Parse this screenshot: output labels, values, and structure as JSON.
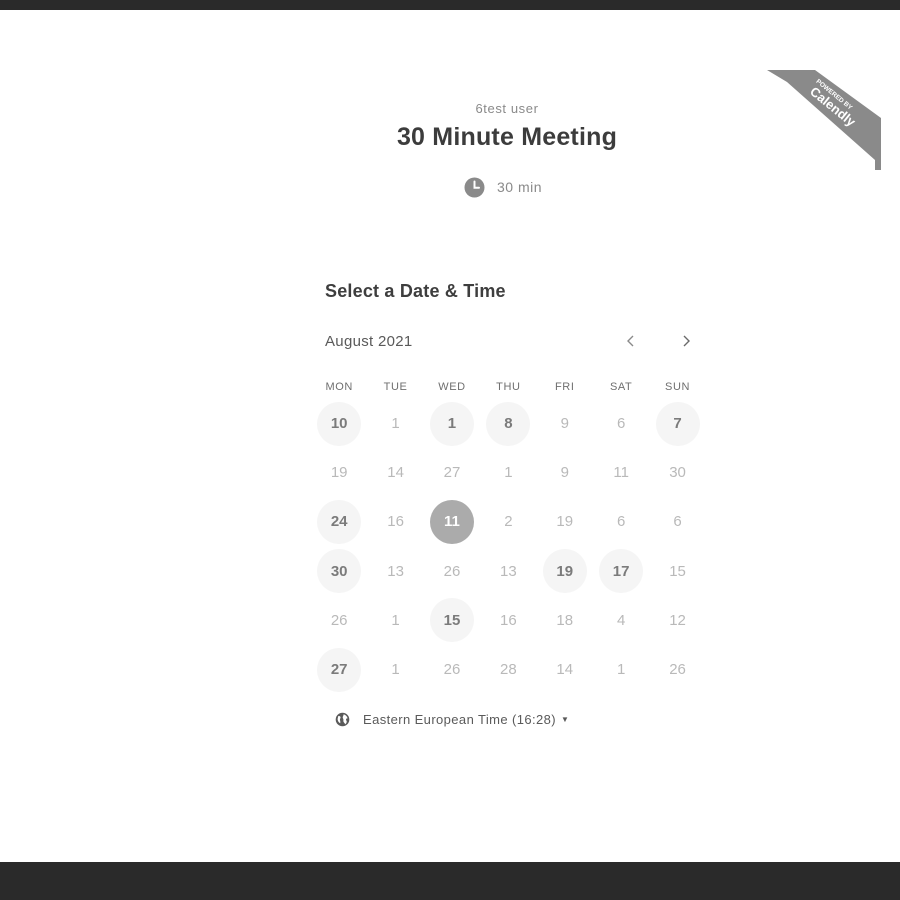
{
  "organizer": "6test user",
  "event_title": "30 Minute Meeting",
  "duration": "30 min",
  "ribbon": {
    "line1": "POWERED BY",
    "line2": "Calendly"
  },
  "section_title": "Select a Date & Time",
  "calendar": {
    "month_label": "August 2021",
    "weekdays": [
      "MON",
      "TUE",
      "WED",
      "THU",
      "FRI",
      "SAT",
      "SUN"
    ],
    "days": [
      {
        "label": "10",
        "state": "available"
      },
      {
        "label": "1",
        "state": "unavailable"
      },
      {
        "label": "1",
        "state": "available"
      },
      {
        "label": "8",
        "state": "available"
      },
      {
        "label": "9",
        "state": "unavailable"
      },
      {
        "label": "6",
        "state": "unavailable"
      },
      {
        "label": "7",
        "state": "available"
      },
      {
        "label": "19",
        "state": "unavailable"
      },
      {
        "label": "14",
        "state": "unavailable"
      },
      {
        "label": "27",
        "state": "unavailable"
      },
      {
        "label": "1",
        "state": "unavailable"
      },
      {
        "label": "9",
        "state": "unavailable"
      },
      {
        "label": "11",
        "state": "unavailable"
      },
      {
        "label": "30",
        "state": "unavailable"
      },
      {
        "label": "24",
        "state": "available"
      },
      {
        "label": "16",
        "state": "unavailable"
      },
      {
        "label": "11",
        "state": "selected"
      },
      {
        "label": "2",
        "state": "unavailable"
      },
      {
        "label": "19",
        "state": "unavailable"
      },
      {
        "label": "6",
        "state": "unavailable"
      },
      {
        "label": "6",
        "state": "unavailable"
      },
      {
        "label": "30",
        "state": "available"
      },
      {
        "label": "13",
        "state": "unavailable"
      },
      {
        "label": "26",
        "state": "unavailable"
      },
      {
        "label": "13",
        "state": "unavailable"
      },
      {
        "label": "19",
        "state": "available"
      },
      {
        "label": "17",
        "state": "available"
      },
      {
        "label": "15",
        "state": "unavailable"
      },
      {
        "label": "26",
        "state": "unavailable"
      },
      {
        "label": "1",
        "state": "unavailable"
      },
      {
        "label": "15",
        "state": "available"
      },
      {
        "label": "16",
        "state": "unavailable"
      },
      {
        "label": "18",
        "state": "unavailable"
      },
      {
        "label": "4",
        "state": "unavailable"
      },
      {
        "label": "12",
        "state": "unavailable"
      },
      {
        "label": "27",
        "state": "available"
      },
      {
        "label": "1",
        "state": "unavailable"
      },
      {
        "label": "26",
        "state": "unavailable"
      },
      {
        "label": "28",
        "state": "unavailable"
      },
      {
        "label": "14",
        "state": "unavailable"
      },
      {
        "label": "1",
        "state": "unavailable"
      },
      {
        "label": "26",
        "state": "unavailable"
      }
    ]
  },
  "timezone": "Eastern European Time (16:28)",
  "icons": {
    "duration": "clock-icon",
    "prev": "chevron-left-icon",
    "next": "chevron-right-icon",
    "timezone": "globe-icon",
    "dropdown": "caret-down-icon"
  },
  "colors": {
    "selected_day": "#ababab",
    "available_day_bg": "#f5f5f5",
    "ribbon": "#8a8a8a",
    "frame_bar": "#2a2a2a"
  }
}
